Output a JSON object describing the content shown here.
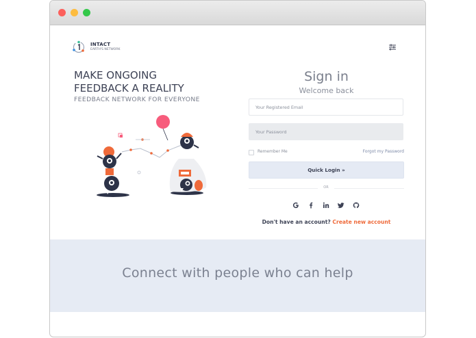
{
  "window": {
    "controls": [
      "close",
      "minimize",
      "maximize"
    ]
  },
  "header": {
    "brand": "INTACT",
    "tagline": "EARTH'S NETWORK",
    "logo_icon": "intact-logo-icon",
    "menu_icon": "sliders-icon"
  },
  "hero": {
    "line1": "MAKE ONGOING",
    "line2": "FEEDBACK A REALITY",
    "subtitle": "FEEDBACK NETWORK FOR EVERYONE",
    "illustration": "monsters-illustration"
  },
  "signin": {
    "title": "Sign in",
    "welcome": "Welcome back",
    "email_placeholder": "Your Registered Email",
    "password_placeholder": "Your Password",
    "remember_label": "Remember Me",
    "forgot_label": "Forgot my Password",
    "login_label": "Quick Login »",
    "or_label": "OR",
    "social": [
      "google-icon",
      "facebook-icon",
      "linkedin-icon",
      "twitter-icon",
      "github-icon"
    ],
    "no_account_text": "Don't have an account?",
    "create_account_label": "Create new account"
  },
  "band": {
    "text": "Connect with people who can help"
  },
  "colors": {
    "accent": "#ef6a3a",
    "band_bg": "#e6ebf4",
    "text_dark": "#3d4255",
    "pink": "#f75c7c"
  }
}
